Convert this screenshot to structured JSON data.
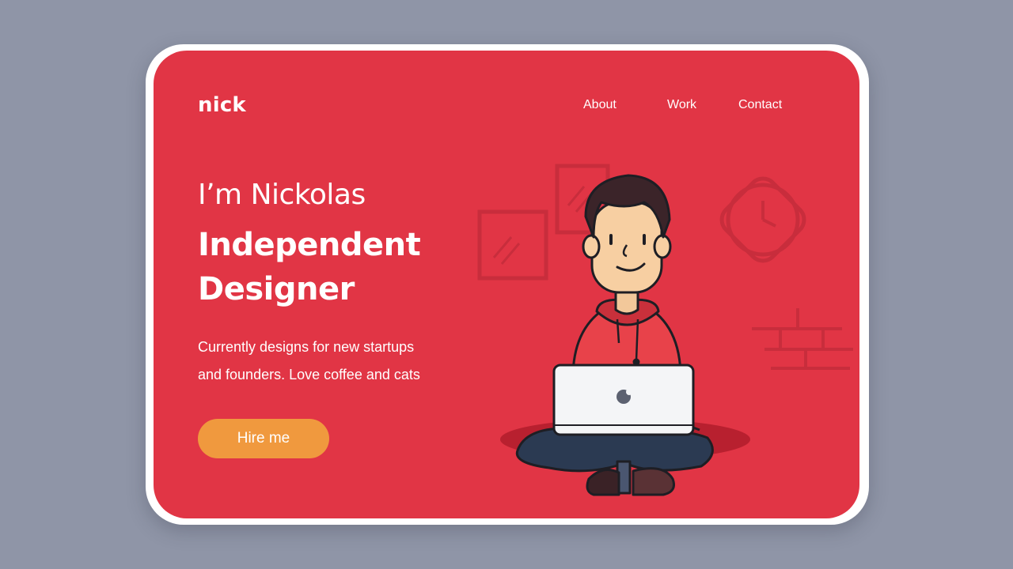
{
  "brand": {
    "logo": "nick"
  },
  "nav": {
    "items": [
      "About",
      "Work",
      "Contact"
    ]
  },
  "hero": {
    "greeting": "I’m Nickolas",
    "headline_line1": "Independent",
    "headline_line2": "Designer",
    "description_line1": "Currently designs for new startups",
    "description_line2": "and founders. Love coffee and cats",
    "cta_label": "Hire me"
  },
  "colors": {
    "page_background": "#8f95a7",
    "card_background": "#e13545",
    "cta_background": "#f0993e",
    "text": "#ffffff"
  },
  "illustration": {
    "subject": "person-with-laptop-icon",
    "decor": [
      "picture-frame-icon",
      "wall-clock-icon",
      "brick-wall-icon",
      "apple-logo-icon"
    ]
  }
}
